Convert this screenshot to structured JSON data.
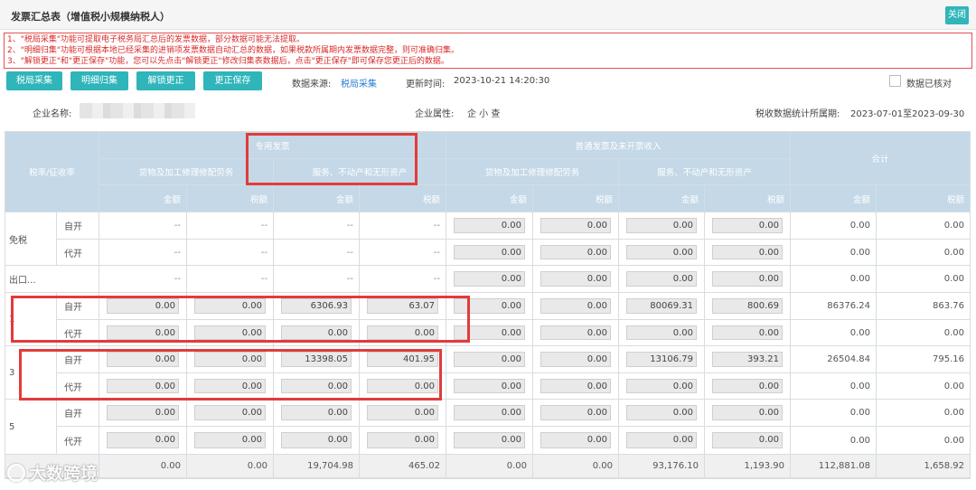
{
  "window": {
    "title": "发票汇总表（增值税小规模纳税人）",
    "close_label": "关闭"
  },
  "notices": [
    "1、\"税局采集\"功能可提取电子税务局汇总后的发票数据，部分数据可能无法提取。",
    "2、\"明细归集\"功能可根据本地已经采集的进销项发票数据自动汇总的数据，如果税款所属期内发票数据完整，则可准确归集。",
    "3、\"解锁更正\"和\"更正保存\"功能，您可以先点击\"解锁更正\"修改归集表数据后，点击\"更正保存\"即可保存您更正后的数据。"
  ],
  "toolbar": {
    "buttons": [
      "税局采集",
      "明细归集",
      "解锁更正",
      "更正保存"
    ],
    "source_label": "数据来源:",
    "source_value": "税局采集",
    "updated_label": "更新时间:",
    "updated_value": "2023-10-21 14:20:30",
    "verified_label": "数据已核对"
  },
  "info": {
    "company_label": "企业名称:",
    "attr_label": "企业属性:",
    "attr_value": "企 小 查",
    "period_label": "税收数据统计所属期:",
    "period_value": "2023-07-01至2023-09-30"
  },
  "table": {
    "rate_header": "税率/征收率",
    "special": "专用发票",
    "normal": "普通发票及未开票收入",
    "total": "合计",
    "goods": "货物及加工修理修配劳务",
    "services": "服务、不动产和无形资产",
    "amount": "金额",
    "tax": "税额",
    "rows": [
      {
        "group": "免税",
        "sub": "自开",
        "vals": [
          "--",
          "--",
          "--",
          "--",
          "0.00",
          "0.00",
          "0.00",
          "0.00",
          "0.00",
          "0.00"
        ]
      },
      {
        "group": "",
        "sub": "代开",
        "vals": [
          "--",
          "--",
          "--",
          "--",
          "0.00",
          "0.00",
          "0.00",
          "0.00",
          "0.00",
          "0.00"
        ]
      },
      {
        "group": "出口...",
        "sub": "",
        "vals": [
          "--",
          "--",
          "--",
          "--",
          "0.00",
          "0.00",
          "0.00",
          "0.00",
          "0.00",
          "0.00"
        ]
      },
      {
        "group": "1",
        "sub": "自开",
        "vals": [
          "0.00",
          "0.00",
          "6306.93",
          "63.07",
          "0.00",
          "0.00",
          "80069.31",
          "800.69",
          "86376.24",
          "863.76"
        ]
      },
      {
        "group": "",
        "sub": "代开",
        "vals": [
          "0.00",
          "0.00",
          "0.00",
          "0.00",
          "0.00",
          "0.00",
          "0.00",
          "0.00",
          "0.00",
          "0.00"
        ]
      },
      {
        "group": "3",
        "sub": "自开",
        "vals": [
          "0.00",
          "0.00",
          "13398.05",
          "401.95",
          "0.00",
          "0.00",
          "13106.79",
          "393.21",
          "26504.84",
          "795.16"
        ]
      },
      {
        "group": "",
        "sub": "代开",
        "vals": [
          "0.00",
          "0.00",
          "0.00",
          "0.00",
          "0.00",
          "0.00",
          "0.00",
          "0.00",
          "0.00",
          "0.00"
        ]
      },
      {
        "group": "5",
        "sub": "自开",
        "vals": [
          "0.00",
          "0.00",
          "0.00",
          "0.00",
          "0.00",
          "0.00",
          "0.00",
          "0.00",
          "0.00",
          "0.00"
        ]
      },
      {
        "group": "",
        "sub": "代开",
        "vals": [
          "0.00",
          "0.00",
          "0.00",
          "0.00",
          "0.00",
          "0.00",
          "0.00",
          "0.00",
          "0.00",
          "0.00"
        ]
      }
    ],
    "total_row": [
      "0.00",
      "0.00",
      "19,704.98",
      "465.02",
      "0.00",
      "0.00",
      "93,176.10",
      "1,193.90",
      "112,881.08",
      "1,658.92"
    ]
  },
  "watermark": "大数跨境"
}
